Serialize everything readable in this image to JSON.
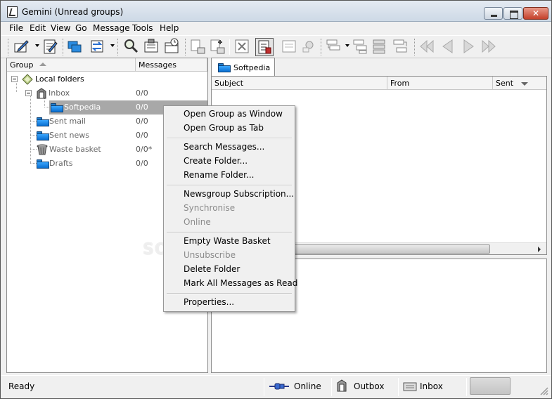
{
  "window": {
    "title": "Gemini (Unread groups)"
  },
  "menubar": {
    "items": [
      "File",
      "Edit",
      "View",
      "Go",
      "Message",
      "Tools",
      "Help"
    ]
  },
  "toolbar": {
    "icons": [
      "compose-icon",
      "address-book-icon",
      "groups-icon",
      "transfer-icon",
      "search-icon",
      "news-icon",
      "scheduler-icon",
      "reply-group-icon",
      "reply-all-icon",
      "delete-icon",
      "message-pane-icon",
      "post-icon",
      "attach-icon",
      "thread-icon",
      "filter-icon",
      "rules-icon",
      "sort-icon",
      "first-icon",
      "previous-icon",
      "next-icon",
      "last-icon"
    ]
  },
  "tree": {
    "headers": {
      "group": "Group",
      "messages": "Messages"
    },
    "root": {
      "label": "Local folders"
    },
    "items": [
      {
        "label": "Inbox",
        "count": "0/0",
        "icon": "inbox-icon"
      },
      {
        "label": "Softpedia",
        "count": "0/0",
        "icon": "folder-icon"
      },
      {
        "label": "Sent mail",
        "count": "0/0",
        "icon": "folder-icon"
      },
      {
        "label": "Sent news",
        "count": "0/0",
        "icon": "folder-icon"
      },
      {
        "label": "Waste basket",
        "count": "0/0*",
        "icon": "waste-basket-icon"
      },
      {
        "label": "Drafts",
        "count": "0/0",
        "icon": "folder-icon"
      }
    ]
  },
  "tabs": [
    {
      "label": "Softpedia"
    }
  ],
  "message_list": {
    "headers": {
      "subject": "Subject",
      "from": "From",
      "sent": "Sent"
    }
  },
  "context_menu": {
    "items": [
      {
        "label": "Open Group as Window",
        "enabled": true
      },
      {
        "label": "Open Group as Tab",
        "enabled": true
      },
      {
        "label": "Search Messages...",
        "enabled": true
      },
      {
        "label": "Create Folder...",
        "enabled": true
      },
      {
        "label": "Rename Folder...",
        "enabled": true
      },
      {
        "label": "Newsgroup Subscription...",
        "enabled": true
      },
      {
        "label": "Synchronise",
        "enabled": false
      },
      {
        "label": "Online",
        "enabled": false
      },
      {
        "label": "Empty Waste Basket",
        "enabled": true
      },
      {
        "label": "Unsubscribe",
        "enabled": false
      },
      {
        "label": "Delete Folder",
        "enabled": true
      },
      {
        "label": "Mark All Messages as Read",
        "enabled": true
      },
      {
        "label": "Properties...",
        "enabled": true
      }
    ]
  },
  "watermark": "SOFTPEDIA",
  "statusbar": {
    "ready": "Ready",
    "online": "Online",
    "outbox": "Outbox",
    "inbox": "Inbox"
  },
  "colors": {
    "selection": "#a8a8a8",
    "folder_blue": "#1a86e6",
    "disabled_text": "#8a8a8a"
  }
}
